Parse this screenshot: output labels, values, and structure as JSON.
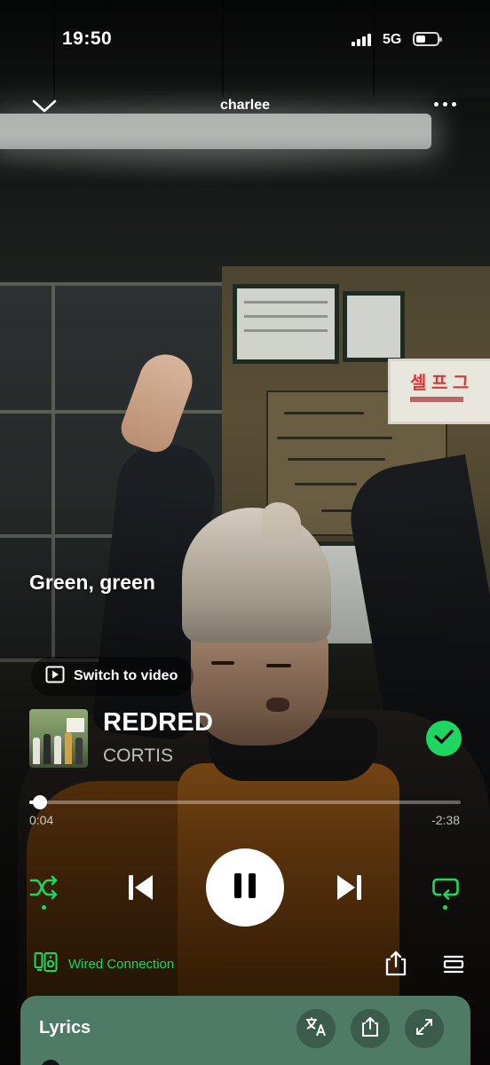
{
  "status_bar": {
    "time": "19:50",
    "network": "5G"
  },
  "header": {
    "title": "charlee"
  },
  "lyric": {
    "current_line": "Green, green"
  },
  "switch_video": {
    "label": "Switch to video"
  },
  "track": {
    "title": "REDRED",
    "artist": "CORTIS",
    "saved": true
  },
  "progress": {
    "elapsed": "0:04",
    "remaining": "-2:38",
    "fraction": 0.025
  },
  "controls": {
    "shuffle_active": true,
    "repeat_active": true,
    "playing": true
  },
  "device": {
    "label": "Wired Connection"
  },
  "lyrics_card": {
    "title": "Lyrics"
  },
  "colors": {
    "accent": "#1ed760",
    "lyrics_card": "#4f7a65"
  },
  "icons": [
    "chevron-down-icon",
    "more-icon",
    "play-video-icon",
    "check-icon",
    "shuffle-icon",
    "previous-icon",
    "pause-icon",
    "next-icon",
    "repeat-icon",
    "speaker-device-icon",
    "share-icon",
    "queue-icon",
    "translate-icon",
    "expand-icon"
  ]
}
